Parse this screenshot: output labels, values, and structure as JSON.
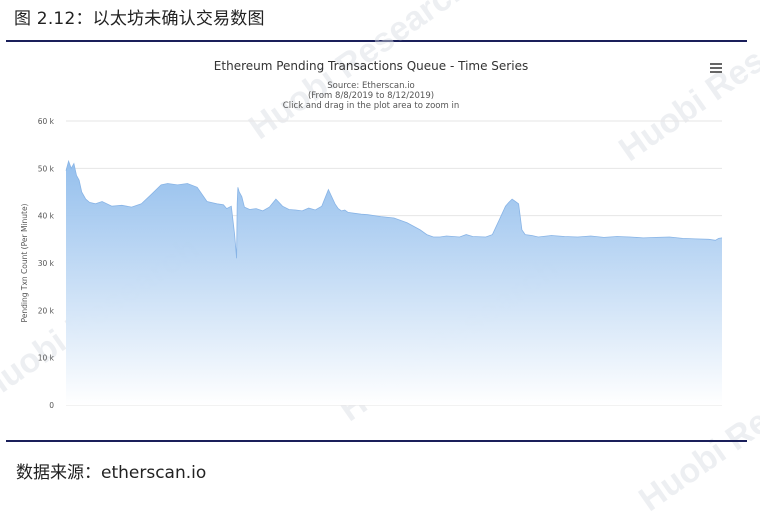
{
  "figure": {
    "caption": "图 2.12：以太坊未确认交易数图",
    "source": "数据来源：etherscan.io"
  },
  "watermark": {
    "text": "Huobi Research"
  },
  "colors": {
    "rule": "#1a1f5a",
    "area_top": "#8fbcec",
    "area_bottom": "#ffffff",
    "line": "#88b4e6"
  },
  "chart_data": {
    "type": "area",
    "title": "Ethereum Pending Transactions Queue - Time Series",
    "subtitle_lines": [
      "Source: Etherscan.io",
      "(From 8/8/2019 to 8/12/2019)",
      "Click and drag in the plot area to zoom in"
    ],
    "ylabel": "Pending Txn Count (Per Minute)",
    "ylim": [
      0,
      60000
    ],
    "yticks": [
      0,
      10000,
      20000,
      30000,
      40000,
      50000,
      60000
    ],
    "ytick_labels": [
      "0",
      "10 k",
      "20 k",
      "30 k",
      "40 k",
      "50 k",
      "60 k"
    ],
    "grid": true,
    "x_range": [
      "8/8/2019",
      "8/12/2019"
    ],
    "x": [
      0,
      0.004,
      0.008,
      0.012,
      0.016,
      0.02,
      0.024,
      0.03,
      0.036,
      0.045,
      0.055,
      0.07,
      0.085,
      0.1,
      0.115,
      0.13,
      0.145,
      0.155,
      0.17,
      0.185,
      0.2,
      0.215,
      0.23,
      0.24,
      0.245,
      0.252,
      0.257,
      0.26,
      0.261,
      0.262,
      0.264,
      0.268,
      0.272,
      0.277,
      0.28,
      0.29,
      0.3,
      0.31,
      0.32,
      0.33,
      0.34,
      0.35,
      0.36,
      0.37,
      0.38,
      0.39,
      0.4,
      0.41,
      0.415,
      0.42,
      0.425,
      0.43,
      0.44,
      0.45,
      0.46,
      0.48,
      0.5,
      0.52,
      0.54,
      0.55,
      0.56,
      0.57,
      0.58,
      0.6,
      0.61,
      0.62,
      0.64,
      0.65,
      0.66,
      0.67,
      0.675,
      0.68,
      0.685,
      0.69,
      0.695,
      0.7,
      0.71,
      0.72,
      0.74,
      0.76,
      0.78,
      0.8,
      0.82,
      0.84,
      0.86,
      0.88,
      0.9,
      0.92,
      0.94,
      0.96,
      0.98,
      0.99,
      0.995,
      1.0
    ],
    "values": [
      49500,
      51500,
      50000,
      51000,
      48500,
      47500,
      45000,
      43500,
      42800,
      42500,
      43000,
      42000,
      42200,
      41800,
      42500,
      44500,
      46500,
      46800,
      46500,
      46800,
      46000,
      43000,
      42500,
      42300,
      41500,
      42000,
      36000,
      31000,
      42500,
      46000,
      45000,
      44000,
      41800,
      41500,
      41300,
      41500,
      41000,
      41800,
      43500,
      42000,
      41300,
      41200,
      41000,
      41600,
      41200,
      42000,
      45500,
      42500,
      41500,
      41000,
      41200,
      40700,
      40500,
      40300,
      40200,
      39800,
      39500,
      38500,
      37000,
      36000,
      35500,
      35500,
      35700,
      35500,
      36000,
      35600,
      35500,
      36000,
      39000,
      42000,
      42800,
      43500,
      43000,
      42500,
      37000,
      36000,
      35800,
      35500,
      35800,
      35600,
      35500,
      35700,
      35400,
      35600,
      35500,
      35300,
      35400,
      35500,
      35200,
      35100,
      35000,
      34800,
      35200,
      35300
    ]
  }
}
